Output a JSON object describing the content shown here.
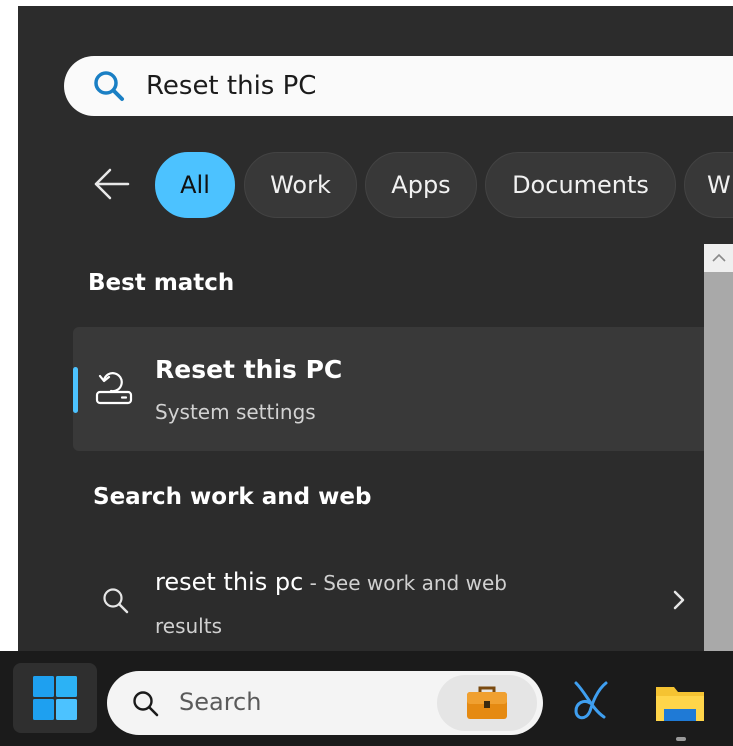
{
  "search": {
    "value": "Reset this PC"
  },
  "filters": [
    "All",
    "Work",
    "Apps",
    "Documents",
    "W"
  ],
  "best_match": {
    "heading": "Best match",
    "title": "Reset this PC",
    "subtitle": "System settings"
  },
  "web": {
    "heading": "Search work and web",
    "query": "reset this pc",
    "suffix": " - See work and web",
    "suffix_line2": "results"
  },
  "taskbar": {
    "search_label": "Search"
  },
  "colors": {
    "accent": "#4cc2ff",
    "panel": "#2c2c2c",
    "taskbar": "#1b1b1b"
  }
}
